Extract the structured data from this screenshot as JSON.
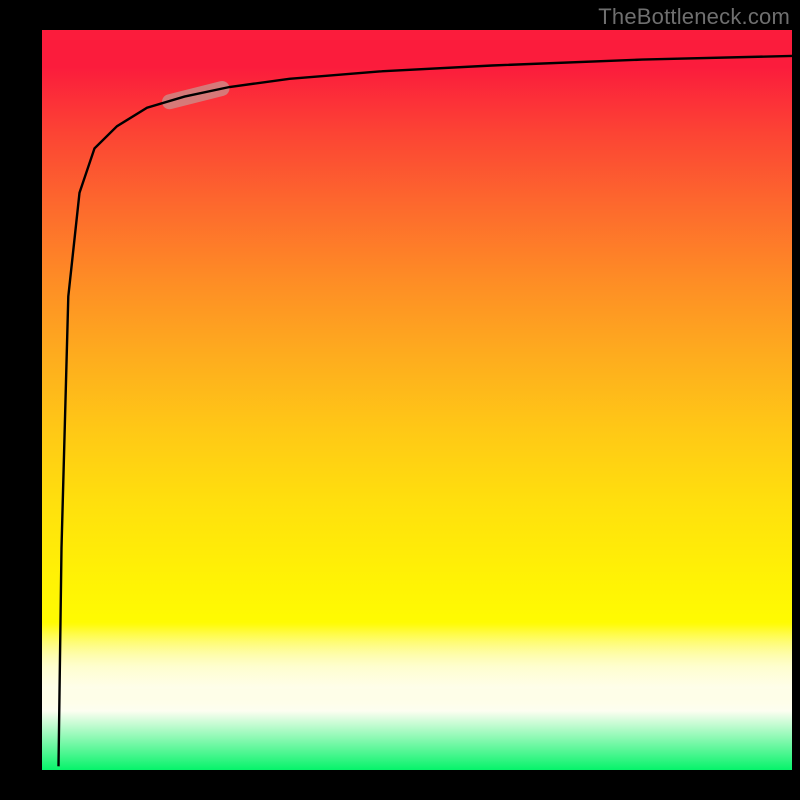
{
  "attribution": "TheBottleneck.com",
  "chart_data": {
    "type": "line",
    "title": "",
    "xlabel": "",
    "ylabel": "",
    "xlim": [
      0,
      100
    ],
    "ylim": [
      0,
      100
    ],
    "grid": false,
    "legend": null,
    "series": [
      {
        "name": "curve",
        "x": [
          2.2,
          2.6,
          3.5,
          5.0,
          7.0,
          10,
          14,
          19,
          25,
          33,
          45,
          60,
          80,
          100
        ],
        "y": [
          0.5,
          30,
          64,
          78,
          84,
          87,
          89.5,
          91,
          92.3,
          93.4,
          94.4,
          95.2,
          96,
          96.5
        ]
      }
    ],
    "highlight": {
      "x_start": 17,
      "x_end": 24,
      "y_start": 90.3,
      "y_end": 92.1
    },
    "background_gradient": {
      "direction": "vertical",
      "stops": [
        {
          "pos": 0.0,
          "color": "#fb1c3c"
        },
        {
          "pos": 0.45,
          "color": "#fe8d25"
        },
        {
          "pos": 0.75,
          "color": "#fff205"
        },
        {
          "pos": 0.92,
          "color": "#fdfef1"
        },
        {
          "pos": 1.0,
          "color": "#06f36a"
        }
      ]
    }
  }
}
